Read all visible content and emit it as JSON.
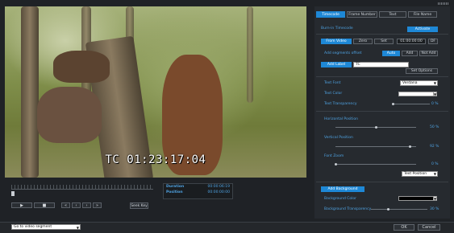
{
  "video": {
    "timecode_overlay": "TC 01:23:17:04"
  },
  "transport": {
    "play_icon": "play-icon",
    "stop_icon": "stop-icon",
    "buttons": [
      "«",
      "‹",
      "›",
      "»"
    ],
    "seek_key_label": "Seek Key"
  },
  "info": {
    "duration_label": "Duration",
    "duration_value": "00:00:06:19",
    "position_label": "Position",
    "position_value": "00:00:00:00"
  },
  "bottom": {
    "segment_select": "Go to video segment",
    "ok_label": "OK",
    "cancel_label": "Cancel"
  },
  "tabs": [
    "Timecode",
    "Frame Number",
    "Text",
    "File Name"
  ],
  "panel": {
    "burn_label": "Burn-in Timecode",
    "activate_label": "Activate",
    "source_buttons": [
      "From Video",
      "Zero",
      "Set"
    ],
    "timecode_value": "01:00:00:00",
    "fps_label": "DF",
    "segments_label": "Add segments offset",
    "offset_buttons": [
      "Auto",
      "Add",
      "Not Add"
    ],
    "add_label_btn": "Add Label",
    "label_value": "TC",
    "set_options": "Set Options",
    "text_font_label": "Text Font",
    "text_font_value": "Verdana",
    "text_color_label": "Text Color",
    "text_transparency_label": "Text Transparency",
    "text_transparency_value": "0 %",
    "horizontal_label": "Horizontal Position",
    "horizontal_value": "50 %",
    "vertical_label": "Vertical Position",
    "vertical_value": "92 %",
    "font_zoom_label": "Font Zoom",
    "font_zoom_value": "0 %",
    "text_position_value": "Text Position",
    "add_background": "Add Background",
    "bg_color_label": "Background Color",
    "bg_transparency_label": "Background Transparency",
    "bg_transparency_value": "30 %"
  },
  "sliders": {
    "text_transparency": 0,
    "horizontal": 0.5,
    "vertical": 0.92,
    "font_zoom": 0,
    "bg_transparency": 0.3
  },
  "colors": {
    "accent": "#1e88d6",
    "label": "#4fa3e3",
    "text_color": "#ffffff",
    "bg_color": "#000000"
  }
}
